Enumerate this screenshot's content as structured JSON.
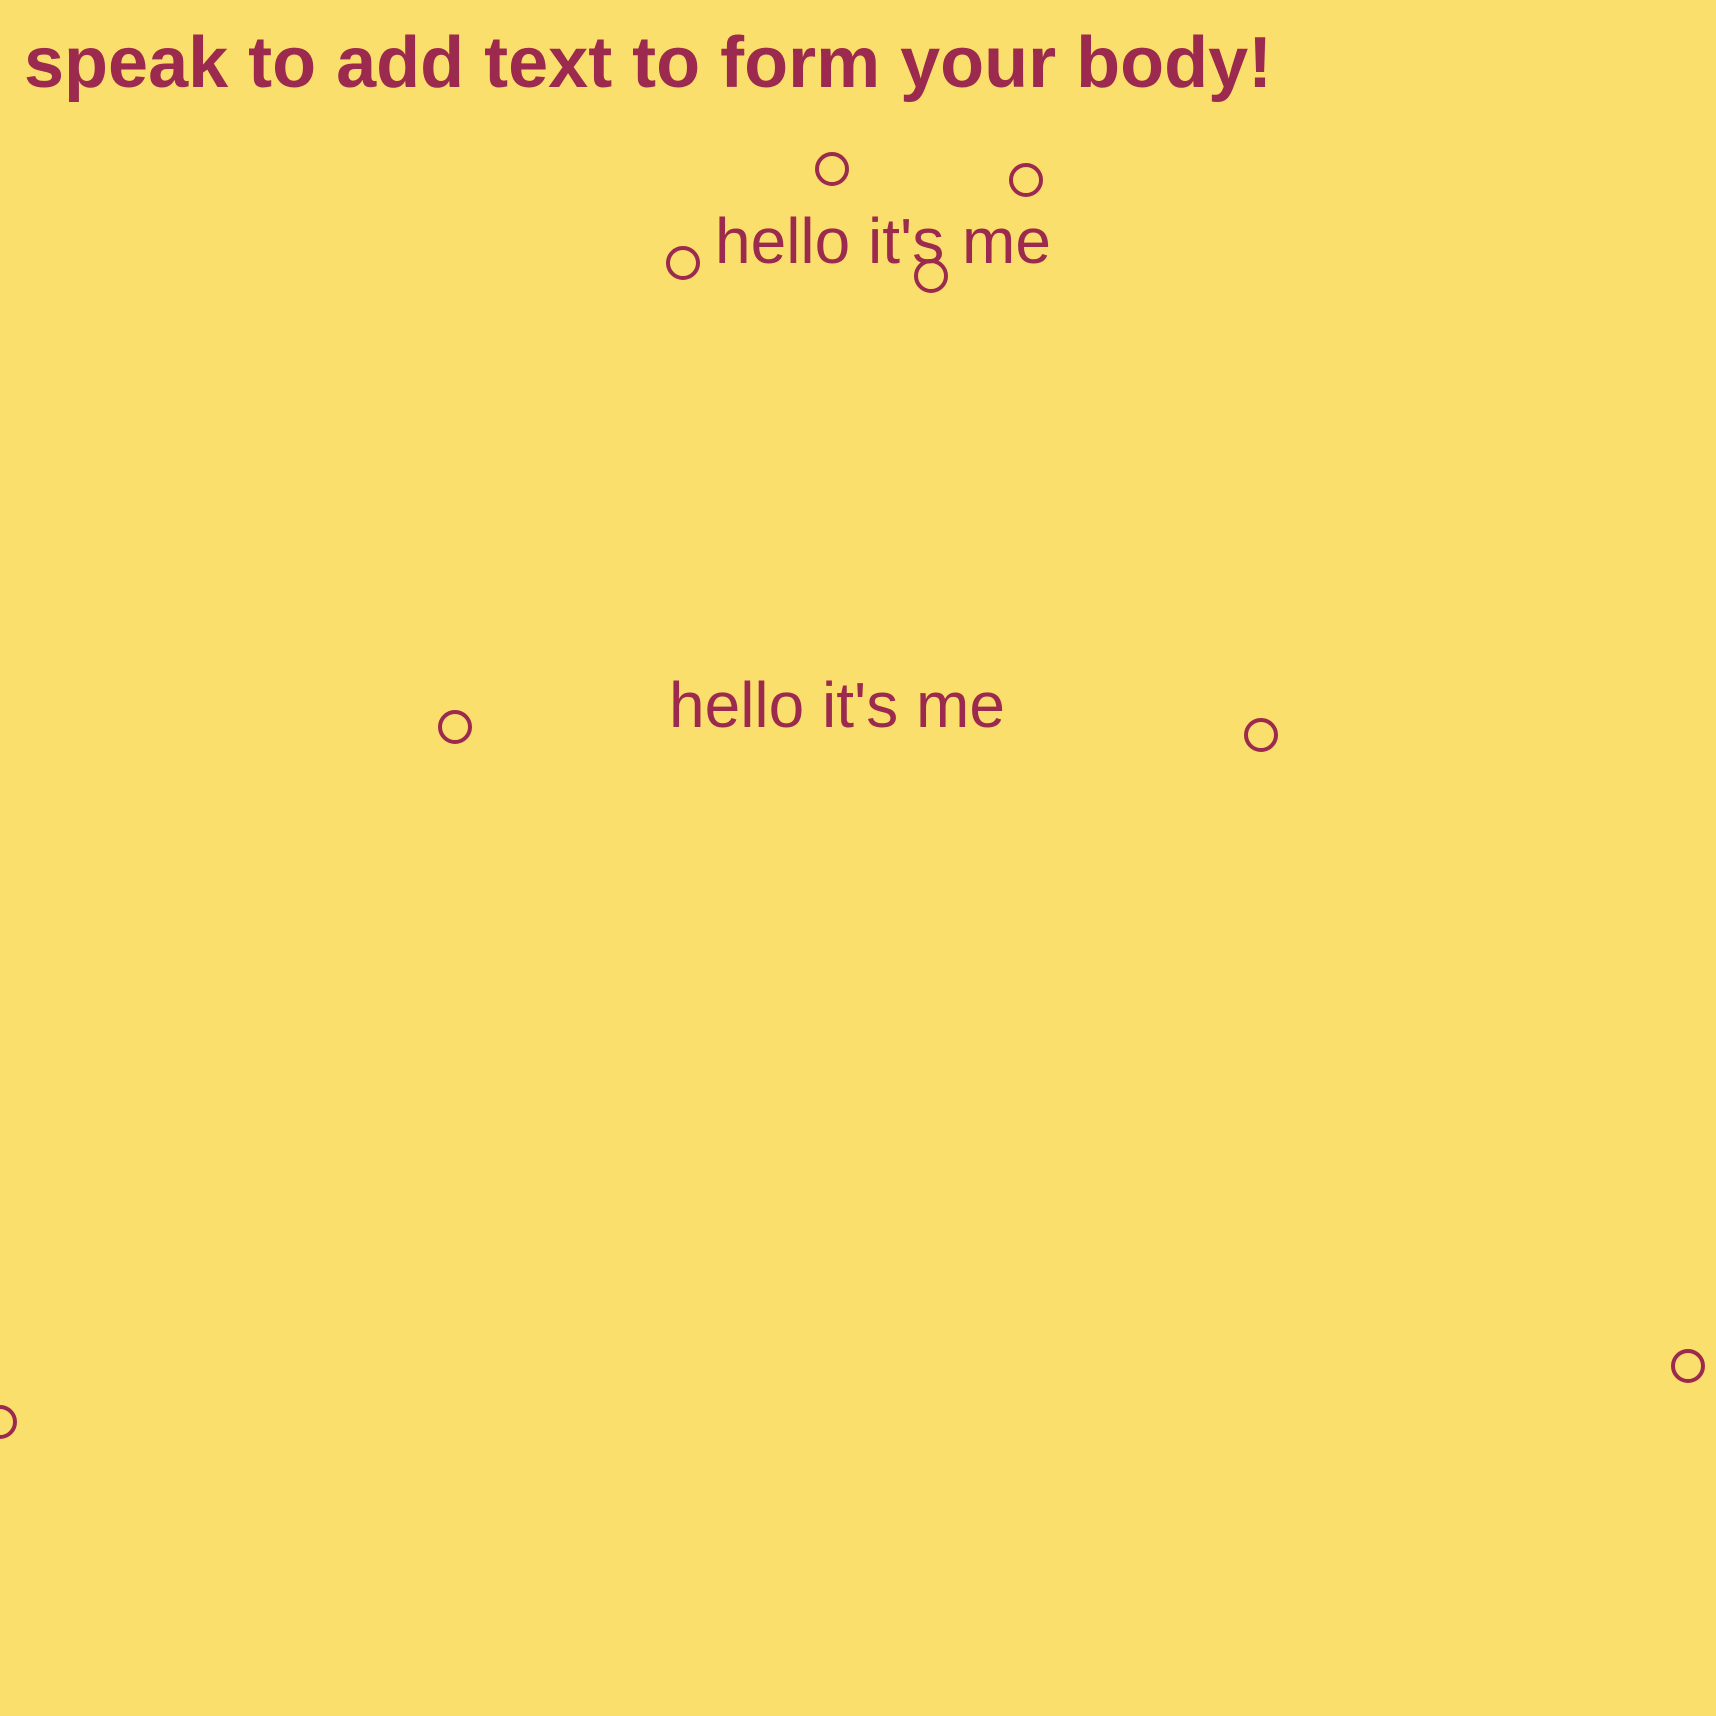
{
  "prompt": {
    "text": "speak to add text to form your body!"
  },
  "body_parts": [
    {
      "text": "hello it's me"
    },
    {
      "text": "hello it's me"
    }
  ],
  "colors": {
    "background": "#fbdf6c",
    "foreground": "#9b2a4e"
  },
  "icons": {
    "node": "circle-outline-icon"
  }
}
